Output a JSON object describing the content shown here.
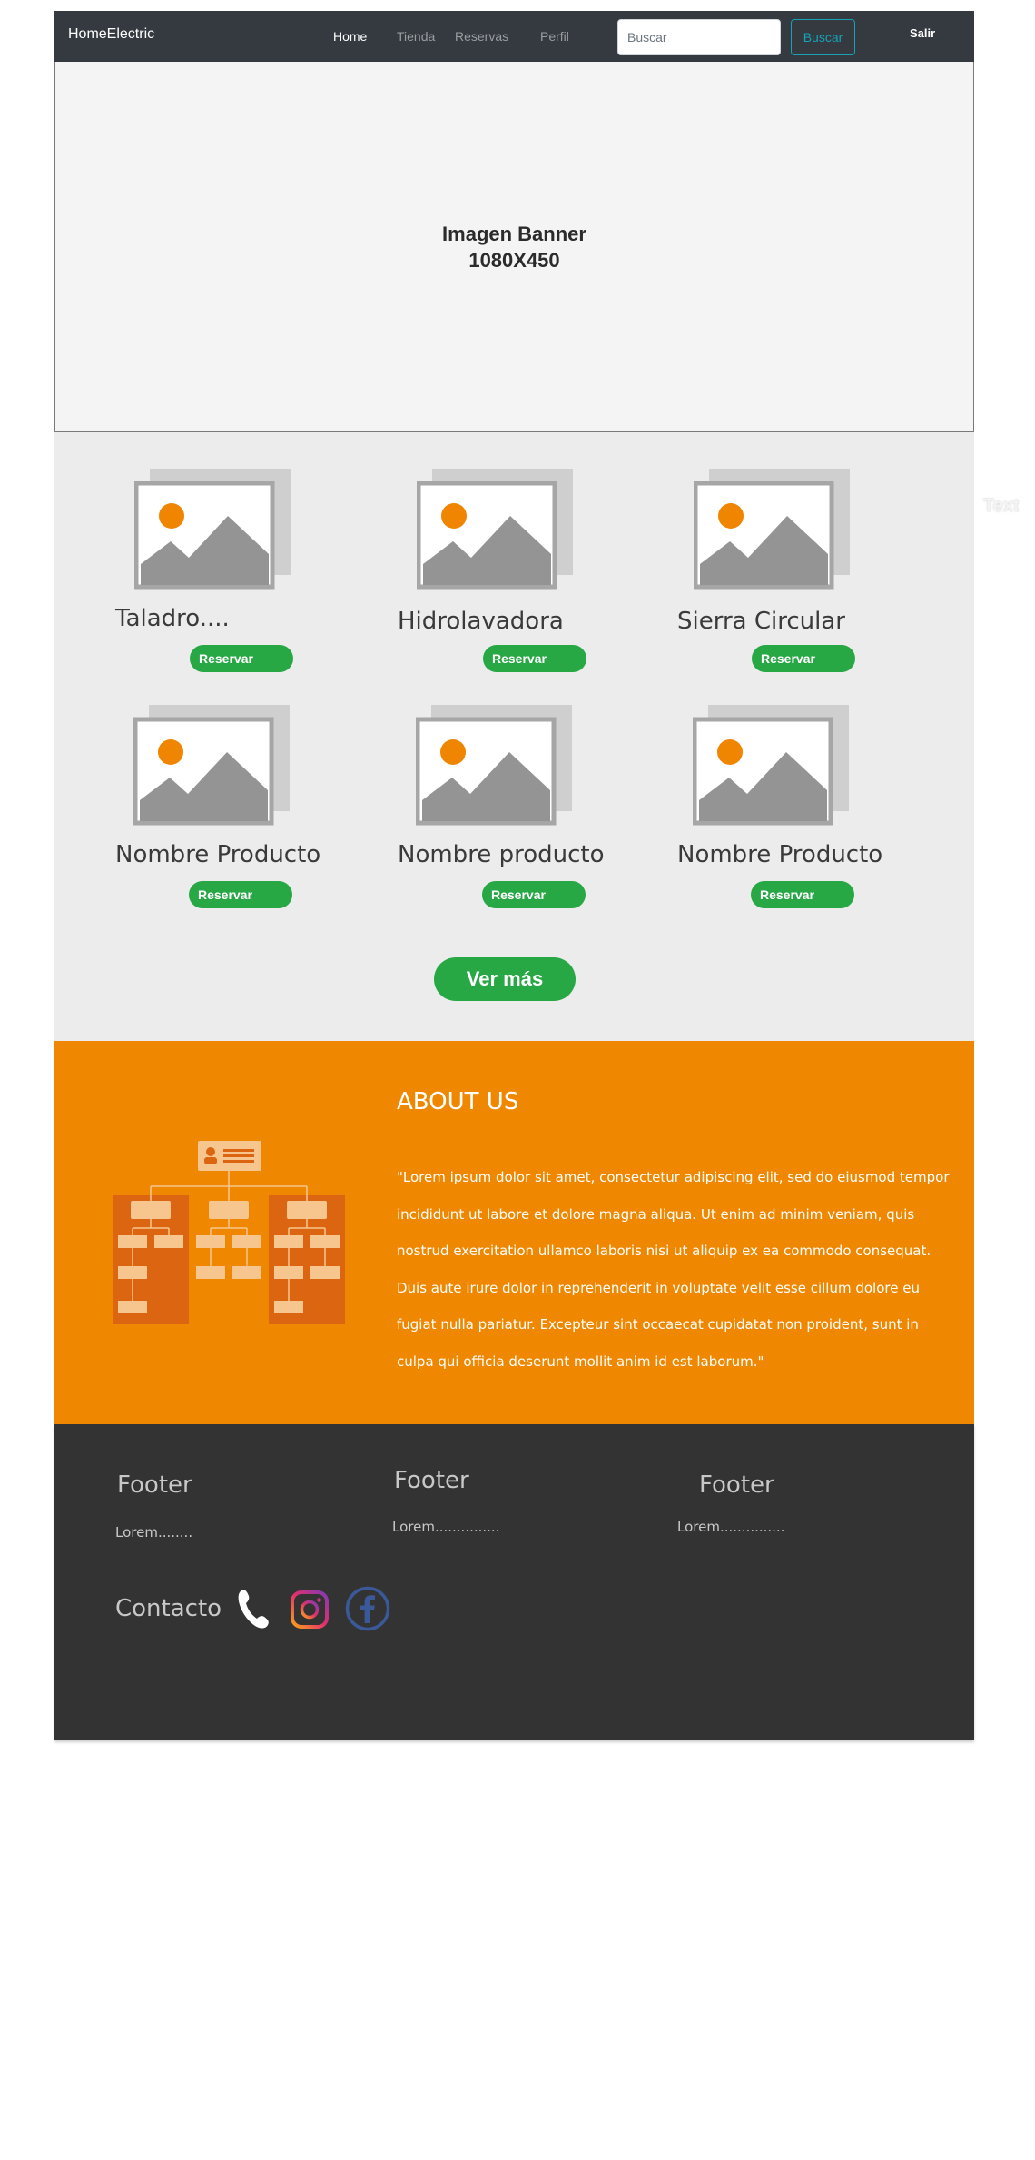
{
  "navbar": {
    "brand": "HomeElectric",
    "links": [
      {
        "label": "Home",
        "active": true
      },
      {
        "label": "Tienda",
        "active": false
      },
      {
        "label": "Reservas",
        "active": false
      },
      {
        "label": "Perfil",
        "active": false
      }
    ],
    "search_placeholder": "Buscar",
    "search_button": "Buscar",
    "logout": "Salir"
  },
  "banner": {
    "line1": "Imagen Banner",
    "line2": "1080X450"
  },
  "products": {
    "items": [
      {
        "name": "Taladro....",
        "button": "Reservar"
      },
      {
        "name": "Hidrolavadora",
        "button": "Reservar"
      },
      {
        "name": "Sierra Circular",
        "button": "Reservar"
      },
      {
        "name": "Nombre Producto",
        "button": "Reservar"
      },
      {
        "name": "Nombre producto",
        "button": "Reservar"
      },
      {
        "name": "Nombre Producto",
        "button": "Reservar"
      }
    ],
    "more_button": "Ver más",
    "side_text": "Text",
    "image_icon": "image-placeholder-icon"
  },
  "about": {
    "title": "ABOUT US",
    "text": "\"Lorem ipsum dolor sit amet, consectetur adipiscing elit, sed do eiusmod tempor incididunt ut labore et dolore magna aliqua. Ut enim ad minim veniam, quis nostrud exercitation ullamco laboris nisi ut aliquip ex ea commodo consequat. Duis aute irure dolor in reprehenderit in voluptate velit esse cillum dolore eu fugiat nulla pariatur. Excepteur sint occaecat cupidatat non proident, sunt in culpa qui officia deserunt mollit anim id est laborum.\"",
    "icon": "org-chart-icon"
  },
  "footer": {
    "columns": [
      {
        "title": "Footer",
        "text": "Lorem........"
      },
      {
        "title": "Footer",
        "text": "Lorem..............."
      },
      {
        "title": "Footer",
        "text": "Lorem..............."
      }
    ],
    "contact_label": "Contacto",
    "icons": [
      "phone-icon",
      "instagram-icon",
      "facebook-icon"
    ]
  },
  "colors": {
    "navbar": "#343a40",
    "accent_green": "#28a745",
    "accent_orange": "#ef8800",
    "search_button_border": "#17a2b8",
    "footer_bg": "#333333",
    "facebook_blue": "#3b5998"
  }
}
